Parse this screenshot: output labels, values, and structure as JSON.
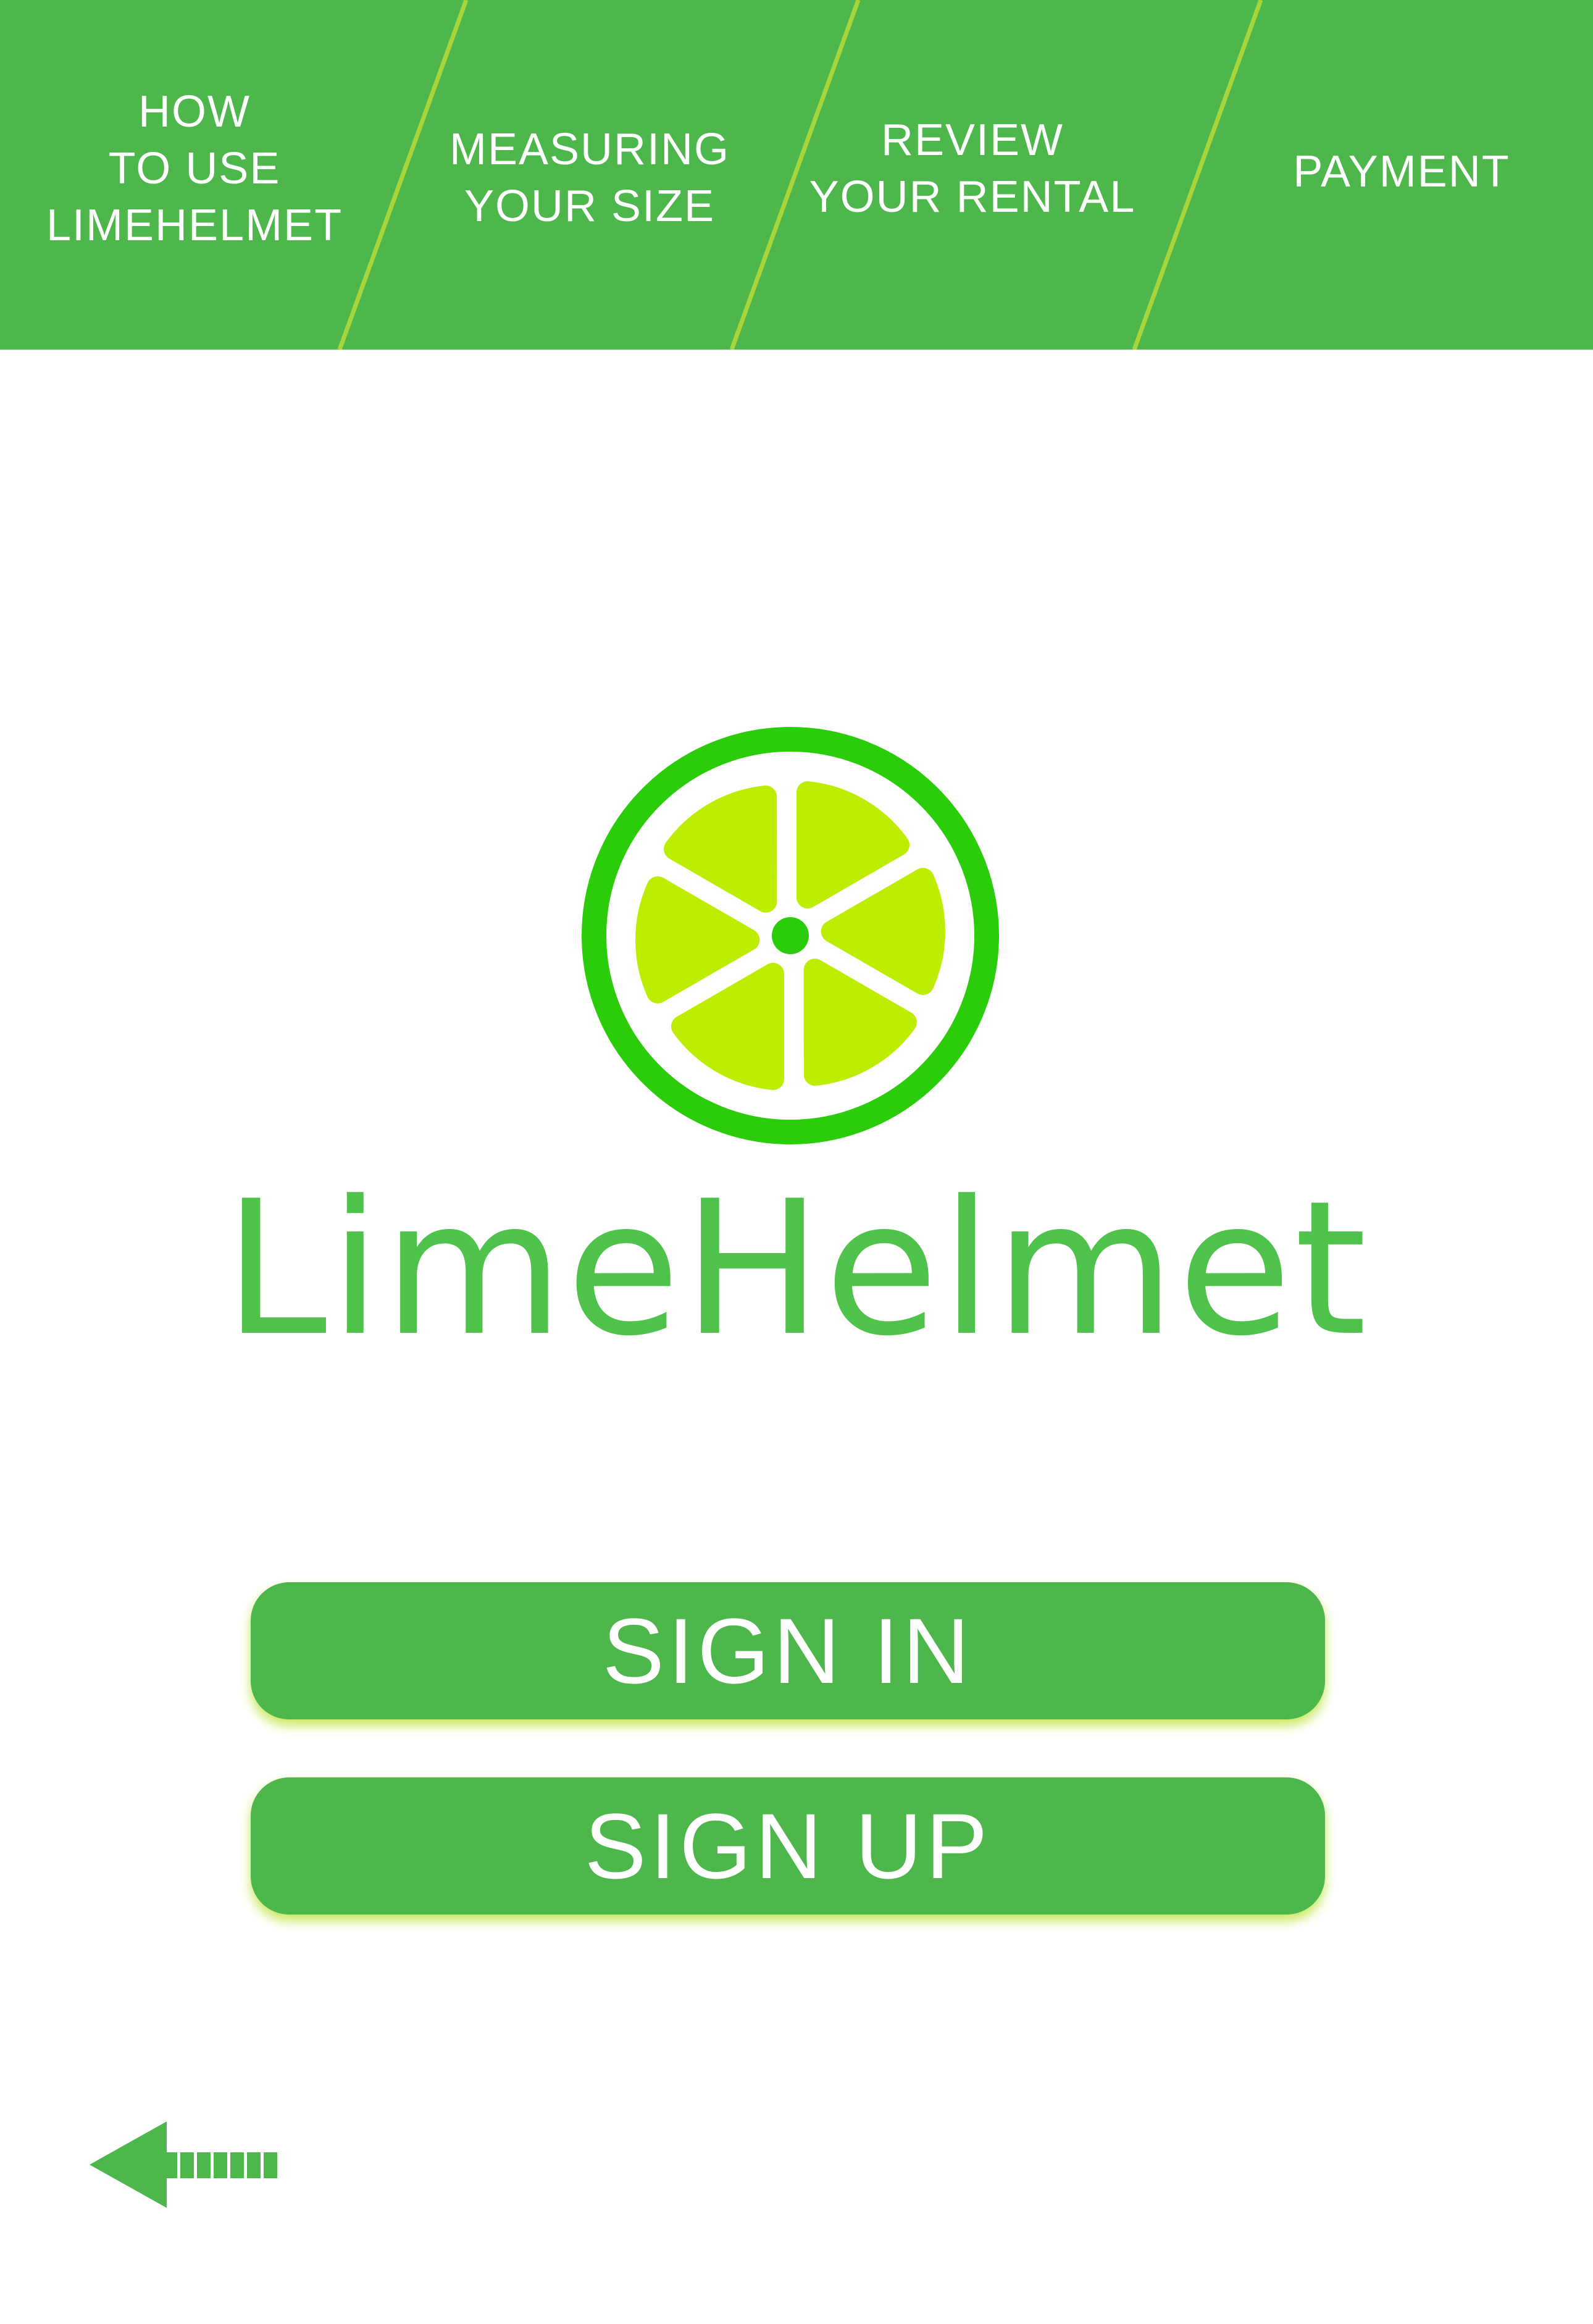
{
  "nav": {
    "tabs": [
      {
        "label": "HOW\nTO USE\nLIMEHELMET"
      },
      {
        "label": "MEASURING\nYOUR SIZE"
      },
      {
        "label": "REVIEW\nYOUR RENTAL"
      },
      {
        "label": "PAYMENT"
      }
    ]
  },
  "brand": {
    "name": "LimeHelmet",
    "logo_icon": "lime-slice-icon"
  },
  "actions": {
    "sign_in": "SIGN IN",
    "sign_up": "SIGN UP"
  },
  "back": {
    "icon": "arrow-left-icon"
  },
  "colors": {
    "header_green": "#4db74b",
    "divider": "#a8d63a",
    "logo_ring": "#2bcc0a",
    "logo_segment": "#bdee00",
    "brand_text": "#4ec24a",
    "button_glow": "#bbe53c"
  }
}
